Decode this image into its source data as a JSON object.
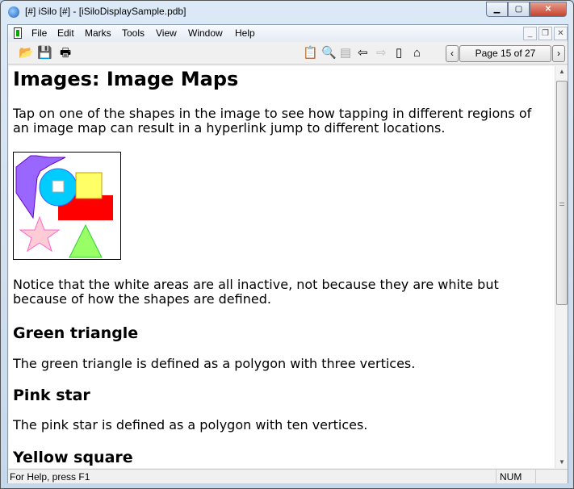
{
  "window": {
    "title": "[#] iSilo [#] - [iSiloDisplaySample.pdb]"
  },
  "menu": [
    "File",
    "Edit",
    "Marks",
    "Tools",
    "View",
    "Window",
    "Help"
  ],
  "toolbar": {
    "page_label": "Page 15 of 27"
  },
  "content": {
    "heading": "Images: Image Maps",
    "intro": "Tap on one of the shapes in the image to see how tapping in different regions of an image map can result in a hyperlink jump to different locations.",
    "notice": "Notice that the white areas are all inactive, not because they are white but because of how the shapes are defined.",
    "sections": [
      {
        "title": "Green triangle",
        "text": "The green triangle is defined as a polygon with three vertices."
      },
      {
        "title": "Pink star",
        "text": "The pink star is defined as a polygon with ten vertices."
      },
      {
        "title": "Yellow square",
        "text": ""
      }
    ]
  },
  "status": {
    "help": "For Help, press F1",
    "num": "NUM"
  }
}
